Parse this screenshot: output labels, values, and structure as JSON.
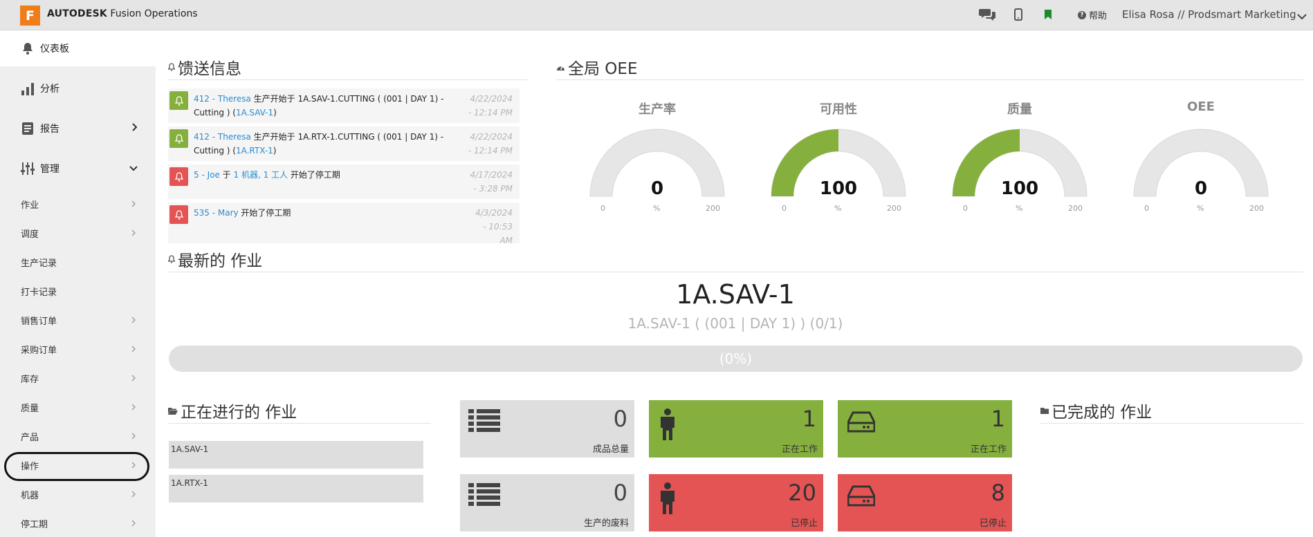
{
  "topbar": {
    "logo_letter": "F",
    "brand_bold": "AUTODESK",
    "brand_rest": "Fusion Operations",
    "help_label": "帮助",
    "user_label": "Elisa Rosa // Prodsmart Marketing"
  },
  "sidebar": {
    "dashboard": "仪表板",
    "analysis": "分析",
    "reports": "报告",
    "manage": "管理",
    "sub_items": [
      "作业",
      "调度",
      "生产记录",
      "打卡记录",
      "销售订单",
      "采购订单",
      "库存",
      "质量",
      "产品",
      "操作",
      "机器",
      "停工期"
    ]
  },
  "feed": {
    "title": "馈送信息",
    "items": [
      {
        "who": "412 - Theresa",
        "text": " 生产开始于 1A.SAV-1.CUTTING ( (001 | DAY 1) - Cutting ) (",
        "link": "1A.SAV-1",
        "tail": ")",
        "date": "4/22/2024",
        "time": "- 12:14 PM",
        "status": "green"
      },
      {
        "who": "412 - Theresa",
        "text": " 生产开始于 1A.RTX-1.CUTTING ( (001 | DAY 1) - Cutting ) (",
        "link": "1A.RTX-1",
        "tail": ")",
        "date": "4/22/2024",
        "time": "- 12:14 PM",
        "status": "green"
      },
      {
        "who": "5 - Joe",
        "text": " 于 ",
        "link": "1 机器, 1 工人",
        "tail": " 开始了停工期",
        "date": "4/17/2024",
        "time": "- 3:28 PM",
        "status": "red"
      },
      {
        "who": "535 - Mary",
        "text": " 开始了停工期",
        "link": "",
        "tail": "",
        "date": "4/3/2024",
        "time": "- 10:53",
        "time2": "AM",
        "status": "red"
      }
    ]
  },
  "oee": {
    "title": "全局 OEE",
    "gauges": [
      {
        "label": "生产率",
        "value": "0",
        "fraction": 0,
        "min": "0",
        "max": "200",
        "unit": "%"
      },
      {
        "label": "可用性",
        "value": "100",
        "fraction": 0.5,
        "min": "0",
        "max": "200",
        "unit": "%"
      },
      {
        "label": "质量",
        "value": "100",
        "fraction": 0.5,
        "min": "0",
        "max": "200",
        "unit": "%"
      },
      {
        "label": "OEE",
        "value": "0",
        "fraction": 0,
        "min": "0",
        "max": "200",
        "unit": "%"
      }
    ]
  },
  "latest_job": {
    "title": "最新的 作业",
    "code": "1A.SAV-1",
    "subtitle": "1A.SAV-1 ( (001 | DAY 1) ) (0/1)",
    "progress_text": "(0%)",
    "progress_fraction": 0
  },
  "in_progress": {
    "title": "正在进行的 作业",
    "items": [
      "1A.SAV-1",
      "1A.RTX-1"
    ]
  },
  "tiles": [
    {
      "value": "0",
      "label": "成品总量",
      "color": "gray",
      "icon": "list-icon"
    },
    {
      "value": "1",
      "label": "正在工作",
      "color": "green",
      "icon": "worker-icon"
    },
    {
      "value": "1",
      "label": "正在工作",
      "color": "green",
      "icon": "machine-icon"
    },
    {
      "value": "0",
      "label": "生产的废料",
      "color": "gray",
      "icon": "list-icon"
    },
    {
      "value": "20",
      "label": "已停止",
      "color": "red",
      "icon": "worker-icon"
    },
    {
      "value": "8",
      "label": "已停止",
      "color": "red",
      "icon": "machine-icon"
    }
  ],
  "completed": {
    "title": "已完成的 作业"
  },
  "colors": {
    "accent_green": "#86b03e",
    "accent_red": "#e45454",
    "link_blue": "#2a8bd0",
    "logo_orange": "#ef7d1a"
  }
}
